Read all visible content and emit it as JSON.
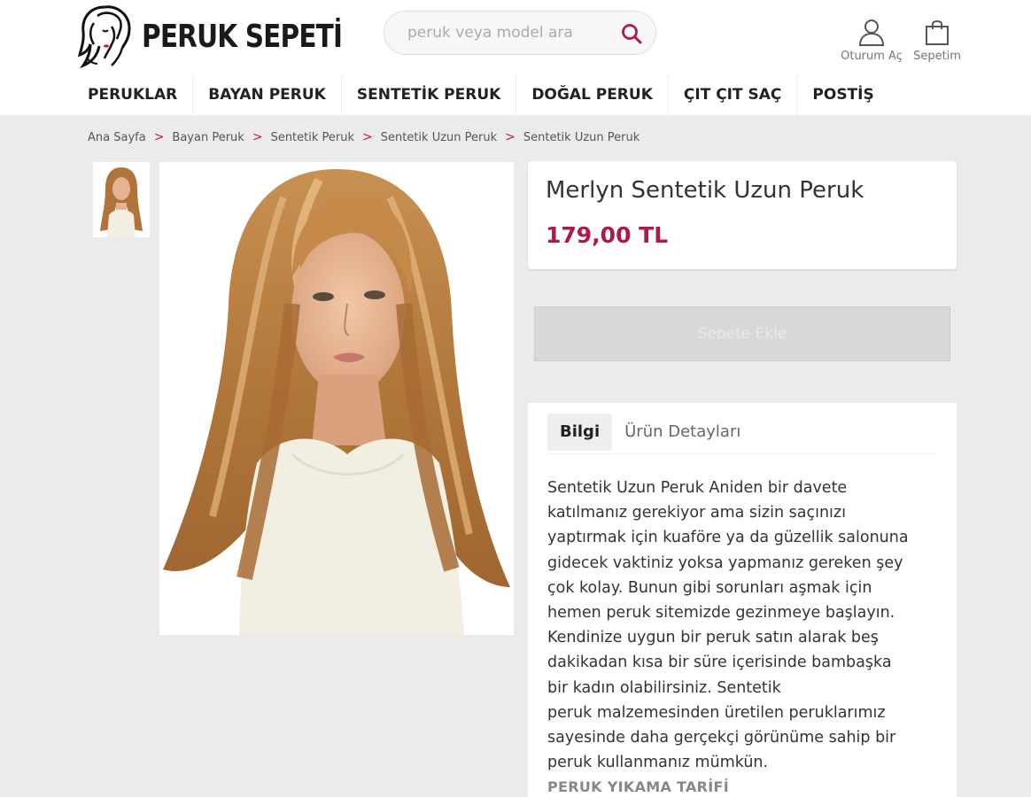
{
  "header": {
    "logo_text": "PERUK SEPETİ",
    "search_placeholder": "peruk veya model ara",
    "login_label": "Oturum Aç",
    "cart_label": "Sepetim"
  },
  "nav": {
    "items": [
      "PERUKLAR",
      "BAYAN PERUK",
      "SENTETİK PERUK",
      "DOĞAL PERUK",
      "ÇIT ÇIT SAÇ",
      "POSTİŞ"
    ]
  },
  "breadcrumb": {
    "items": [
      "Ana Sayfa",
      "Bayan Peruk",
      "Sentetik Peruk",
      "Sentetik Uzun Peruk",
      "Sentetik Uzun Peruk"
    ],
    "separator": ">"
  },
  "product": {
    "title": "Merlyn Sentetik Uzun Peruk",
    "price": "179,00 TL",
    "add_to_cart_label": "Sepete Ekle"
  },
  "tabs": {
    "items": [
      "Bilgi",
      "Ürün Detayları"
    ]
  },
  "description": {
    "lines": [
      "Sentetik Uzun Peruk Aniden bir davete",
      "katılmanız gerekiyor ama sizin saçınızı",
      "yaptırmak için kuaföre ya da güzellik salonuna",
      "gidecek vaktiniz yoksa yapmanız gereken şey",
      "çok kolay. Bunun gibi sorunları aşmak için",
      "hemen peruk sitemizde gezinmeye başlayın.",
      "Kendinize uygun bir peruk satın alarak beş",
      "dakikadan kısa bir süre içerisinde bambaşka",
      "bir kadın olabilirsiniz. Sentetik",
      "peruk malzemesinden üretilen peruklarımız",
      "sayesinde daha gerçekçi görünüme sahip bir",
      "peruk kullanmanız mümkün."
    ],
    "sub_heading": "PERUK YIKAMA TARİFİ"
  },
  "colors": {
    "brand": "#b0174d",
    "background": "#ebebeb"
  },
  "icons": {
    "search": "search-icon",
    "user": "user-icon",
    "cart": "shopping-bag-icon"
  }
}
